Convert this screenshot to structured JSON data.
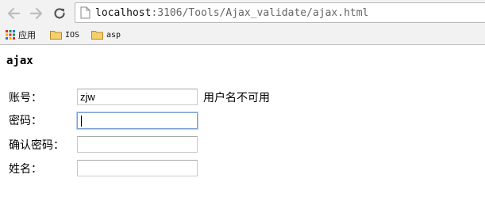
{
  "browser": {
    "url_host": "localhost",
    "url_rest": ":3106/Tools/Ajax_validate/ajax.html",
    "back_icon": "back-arrow-icon",
    "forward_icon": "forward-arrow-icon",
    "reload_icon": "reload-icon"
  },
  "bookmarks": {
    "items": [
      {
        "label": "应用",
        "icon": "apps-grid-icon"
      },
      {
        "label": "IOS",
        "icon": "folder-icon"
      },
      {
        "label": "asp",
        "icon": "folder-icon"
      }
    ]
  },
  "page": {
    "title": "ajax",
    "form": {
      "account_label": "账号：",
      "account_value": "zjw",
      "account_hint": "用户名不可用",
      "password_label": "密码：",
      "confirm_label": "确认密码：",
      "name_label": "姓名："
    }
  },
  "colors": {
    "toolbar_bg": "#f2f2f2",
    "focus_border": "#7da2ce"
  }
}
